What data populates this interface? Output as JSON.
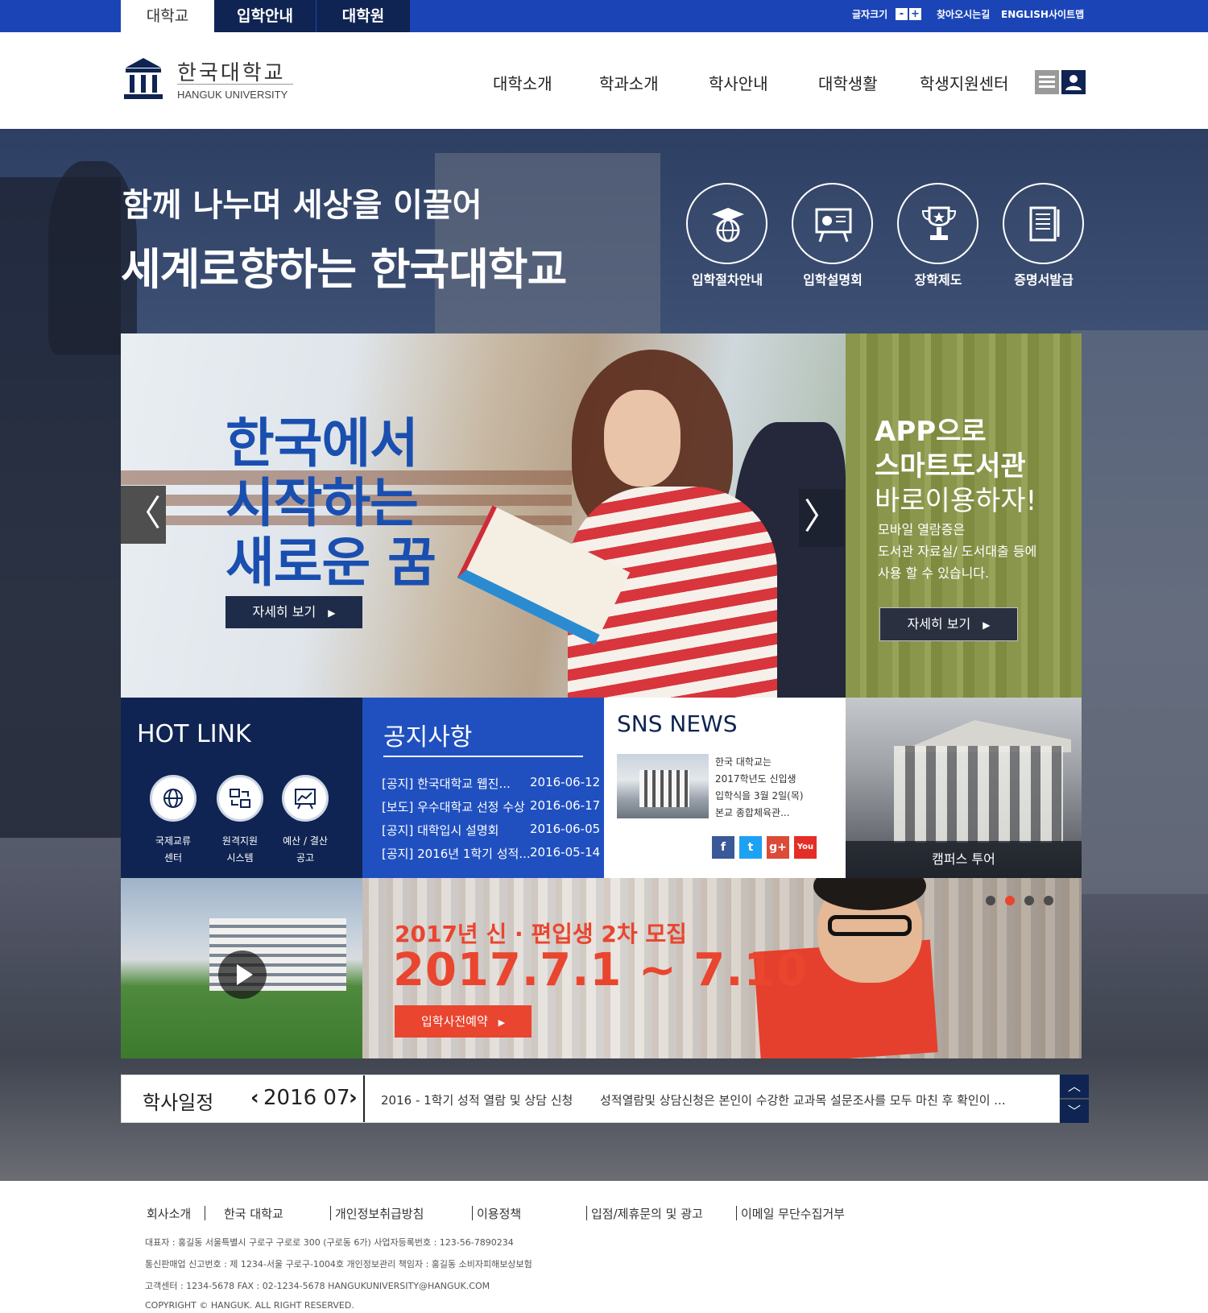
{
  "topbar": {
    "tabs": [
      "대학교",
      "입학안내",
      "대학원"
    ],
    "font_size_label": "글자크기",
    "font_minus": "-",
    "font_plus": "+",
    "util_links": [
      "찾아오시는길",
      "ENGLISH",
      "사이트맵"
    ]
  },
  "header": {
    "logo_kr": "한국대학교",
    "logo_en": "HANGUK UNIVERSITY",
    "nav": [
      "대학소개",
      "학과소개",
      "학사안내",
      "대학생활",
      "학생지원센터"
    ]
  },
  "hero": {
    "line1": "함께 나누며 세상을 이끌어",
    "line2": "세계로향하는 한국대학교",
    "quick_links": [
      {
        "label": "입학절차안내",
        "icon": "graduation-globe-icon"
      },
      {
        "label": "입학설명회",
        "icon": "presentation-board-icon"
      },
      {
        "label": "장학제도",
        "icon": "trophy-icon"
      },
      {
        "label": "증명서발급",
        "icon": "certificate-document-icon"
      }
    ]
  },
  "main_banner": {
    "lines": [
      "한국에서",
      "시작하는",
      "새로운  꿈"
    ],
    "button": "자세히 보기",
    "prev": "〈",
    "next": "〉"
  },
  "app_panel": {
    "title_lines": [
      "APP으로",
      "스마트도서관",
      "바로이용하자!"
    ],
    "desc_lines": [
      "모바일 열람증은",
      "도서관 자료실/ 도서대출 등에",
      "사용 할 수 있습니다."
    ],
    "button": "자세히 보기"
  },
  "hot_link": {
    "title": "HOT LINK",
    "items": [
      {
        "line1": "국제교류",
        "line2": "센터",
        "icon": "globe-network-icon"
      },
      {
        "line1": "원격지원",
        "line2": "시스템",
        "icon": "remote-sync-icon"
      },
      {
        "line1": "예산 / 결산",
        "line2": "공고",
        "icon": "budget-chart-icon"
      }
    ]
  },
  "notice": {
    "title": "공지사항",
    "items": [
      {
        "text": "[공지] 한국대학교 웹진...",
        "date": "2016-06-12"
      },
      {
        "text": "[보도] 우수대학교 선정 수상",
        "date": "2016-06-17"
      },
      {
        "text": "[공지] 대학입시 설명회",
        "date": "2016-06-05"
      },
      {
        "text": "[공지] 2016년 1학기 성적...",
        "date": "2016-05-14"
      }
    ]
  },
  "sns": {
    "title": "SNS NEWS",
    "text_lines": [
      "한국 대학교는",
      "2017학년도 신입생",
      "입학식을 3월 2일(목)",
      "본교 종합체육관..."
    ],
    "icons": [
      {
        "label": "f",
        "icon": "facebook-icon",
        "color": "#3b5998"
      },
      {
        "label": "t",
        "icon": "twitter-icon",
        "color": "#1da1f2"
      },
      {
        "label": "g+",
        "icon": "google-plus-icon",
        "color": "#dc4a38"
      },
      {
        "label": "You",
        "icon": "youtube-icon",
        "color": "#e52d27"
      }
    ]
  },
  "campus": {
    "label": "캠퍼스 투어"
  },
  "recruit": {
    "line1": "2017년 신 · 편입생 2차 모집",
    "line2": "2017.7.1 ~ 7.10",
    "button": "입학사전예약",
    "active_slide": 2,
    "slide_count": 4
  },
  "schedule": {
    "title": "학사일정",
    "prev": "‹",
    "date": "2016 07",
    "next": "›",
    "item_title": "2016 - 1학기 성적 열람 및 상담 신청",
    "item_desc": "성적열람및 상담신청은 본인이 수강한 교과목 설문조사를 모두 마친 후 확인이 ...",
    "up": "︿",
    "down": "﹀"
  },
  "footer": {
    "links": [
      "회사소개",
      "한국 대학교",
      "개인정보취급방침",
      "이용정책",
      "입점/제휴문의 및 광고",
      "이메일 무단수집거부"
    ],
    "info": [
      "대표자 : 홍길동  서울특별시 구로구 구로로 300 (구로동 6가)  사업자등록번호 : 123-56-7890234",
      "통신판매업 신고번호 : 제 1234-서울 구로구-1004호  개인정보관리 책임자 : 홍길동  소비자피해보상보험",
      "고객센터 : 1234-5678  FAX : 02-1234-5678  HANGUKUNIVERSITY@HANGUK.COM",
      "COPYRIGHT  ©  HANGUK. ALL RIGHT RESERVED."
    ]
  },
  "colors": {
    "brand_blue": "#1b45b7",
    "navy": "#0f2452",
    "notice_blue": "#2050c0",
    "accent_red": "#e9452f"
  }
}
